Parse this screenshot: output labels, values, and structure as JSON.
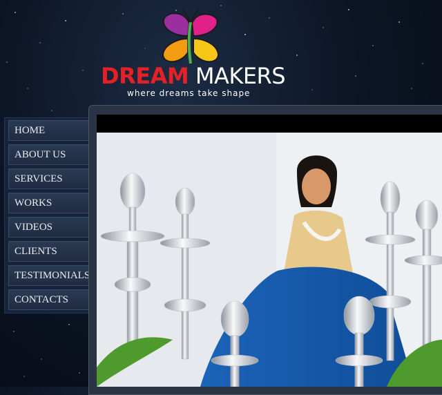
{
  "logo": {
    "brand_first": "DREAM",
    "brand_second": "MAKERS",
    "tagline": "where dreams take shape",
    "colors": {
      "dream": "#e42127",
      "makers": "#ffffff"
    }
  },
  "nav": {
    "items": [
      {
        "label": "HOME"
      },
      {
        "label": "ABOUT US"
      },
      {
        "label": "SERVICES"
      },
      {
        "label": "WORKS"
      },
      {
        "label": "VIDEOS"
      },
      {
        "label": "CLIENTS"
      },
      {
        "label": "TESTIMONIALS"
      },
      {
        "label": "CONTACTS"
      }
    ]
  },
  "main": {
    "photo_icon": "hero-photo-woman-with-silver-lamps"
  }
}
